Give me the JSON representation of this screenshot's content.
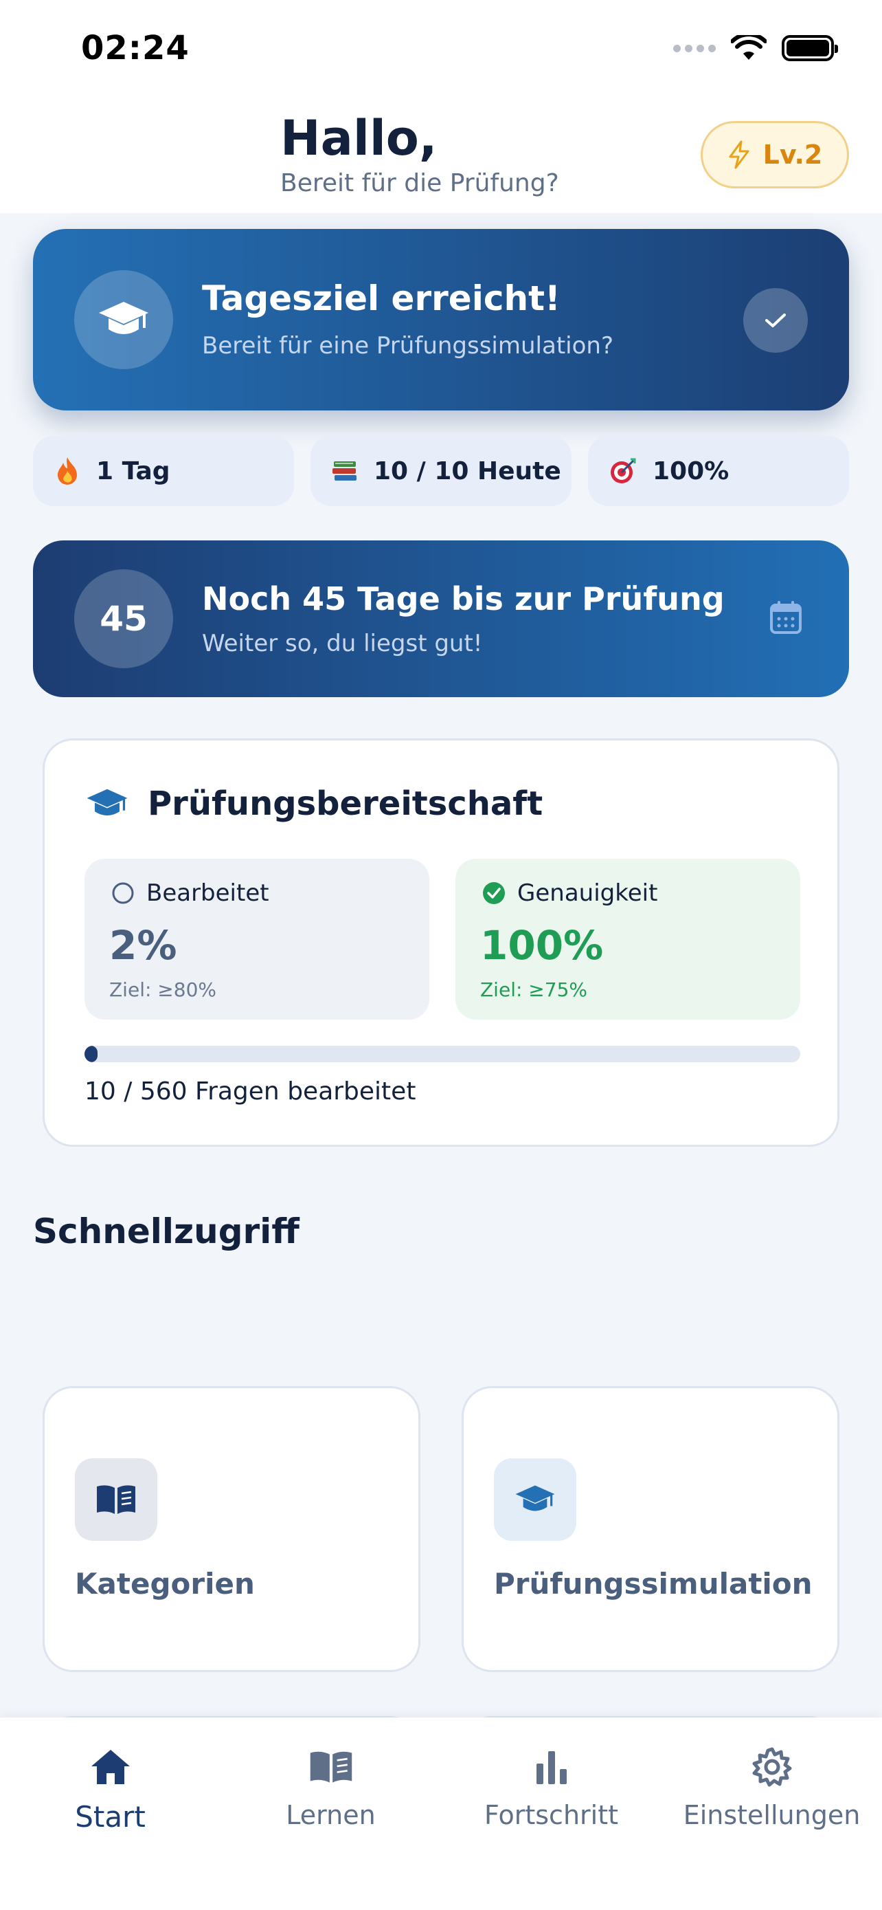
{
  "status_bar": {
    "time": "02:24"
  },
  "header": {
    "greeting": "Hallo,",
    "subtitle": "Bereit für die Prüfung?",
    "level": "Lv.2"
  },
  "goal_card": {
    "title": "Tagesziel erreicht!",
    "subtitle": "Bereit für eine Prüfungssimulation?"
  },
  "stats": [
    {
      "icon": "fire-icon",
      "label": "1 Tag"
    },
    {
      "icon": "books-icon",
      "label": "10 / 10 Heute"
    },
    {
      "icon": "target-icon",
      "label": "100%"
    }
  ],
  "countdown": {
    "days": "45",
    "title": "Noch 45 Tage bis zur Prüfung",
    "subtitle": "Weiter so, du liegst gut!"
  },
  "readiness": {
    "title": "Prüfungsbereitschaft",
    "processed": {
      "label": "Bearbeitet",
      "value": "2%",
      "goal": "Ziel: ≥80%"
    },
    "accuracy": {
      "label": "Genauigkeit",
      "value": "100%",
      "goal": "Ziel: ≥75%"
    },
    "progress_fraction": 0.018,
    "progress_text": "10 / 560 Fragen bearbeitet"
  },
  "quick_access": {
    "title": "Schnellzugriff",
    "tiles": [
      {
        "label": "Kategorien",
        "icon": "book-open-icon"
      },
      {
        "label": "Prüfungssimulation",
        "icon": "graduation-cap-icon"
      }
    ]
  },
  "nav": [
    {
      "label": "Start",
      "icon": "home-icon",
      "active": true
    },
    {
      "label": "Lernen",
      "icon": "book-icon",
      "active": false
    },
    {
      "label": "Fortschritt",
      "icon": "bar-chart-icon",
      "active": false
    },
    {
      "label": "Einstellungen",
      "icon": "gear-icon",
      "active": false
    }
  ],
  "colors": {
    "primary_dark": "#1d3d72",
    "primary": "#2470b5",
    "accent_orange": "#d9860f",
    "success": "#1f9d55",
    "background": "#f2f5fa"
  }
}
